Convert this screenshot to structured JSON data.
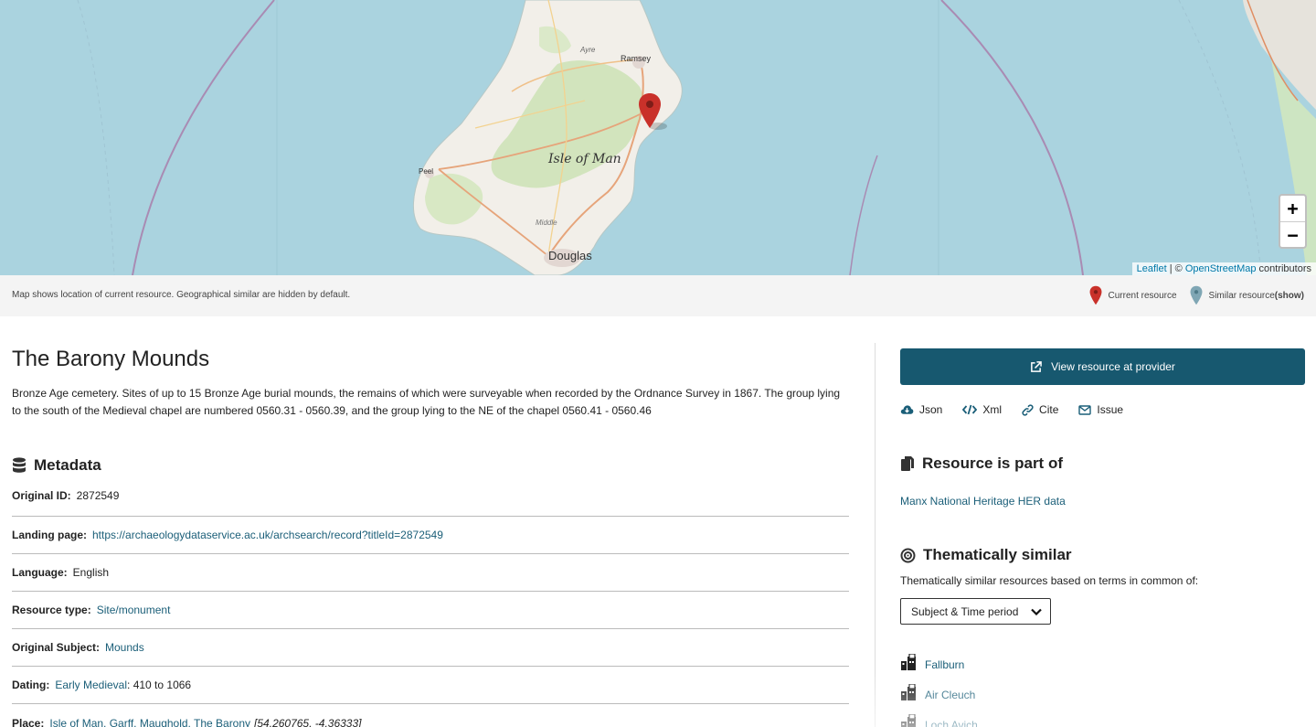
{
  "map": {
    "labels": {
      "isle": "Isle of Man",
      "ramsey": "Ramsey",
      "ayre": "Ayre",
      "peel": "Peel",
      "middle": "Middle",
      "douglas": "Douglas"
    },
    "zoom_in": "+",
    "zoom_out": "−",
    "attribution": {
      "leaflet": "Leaflet",
      "sep": " | © ",
      "osm": "OpenStreetMap",
      "contributors": " contributors"
    }
  },
  "mapbar": {
    "note": "Map shows location of current resource. Geographical similar are hidden by default.",
    "current_label": "Current resource",
    "similar_label": "Similar resource ",
    "similar_show": "(show)",
    "current_color": "#c9312a",
    "similar_color": "#7fa6b4"
  },
  "resource": {
    "title": "The Barony Mounds",
    "description": "Bronze Age cemetery. Sites of up to 15 Bronze Age burial mounds, the remains of which were surveyable when recorded by the Ordnance Survey in 1867. The group lying to the south of the Medieval chapel are numbered 0560.31 - 0560.39, and the group lying to the NE of the chapel 0560.41 - 0560.46"
  },
  "metadata": {
    "heading": "Metadata",
    "icon": "database-icon",
    "rows": {
      "original_id": {
        "label": "Original ID:",
        "value": "2872549"
      },
      "landing_page": {
        "label": "Landing page:",
        "value": "https://archaeologydataservice.ac.uk/archsearch/record?titleId=2872549"
      },
      "language": {
        "label": "Language:",
        "value": "English"
      },
      "resource_type": {
        "label": "Resource type:",
        "value": "Site/monument"
      },
      "original_subject": {
        "label": "Original Subject:",
        "value": "Mounds"
      },
      "dating": {
        "label": "Dating:",
        "link": "Early Medieval",
        "value": ": 410 to 1066"
      },
      "place": {
        "label": "Place:",
        "link": "Isle of Man, Garff, Maughold, The Barony",
        "coords": "[54.260765, -4.36333]"
      }
    }
  },
  "actions": {
    "view_provider": "View resource at provider",
    "json": "Json",
    "xml": "Xml",
    "cite": "Cite",
    "issue": "Issue"
  },
  "part_of": {
    "heading": "Resource is part of",
    "link": "Manx National Heritage HER data"
  },
  "thematic": {
    "heading": "Thematically similar",
    "description": "Thematically similar resources based on terms in common of:",
    "select_value": "Subject & Time period",
    "items": [
      "Fallburn",
      "Air Cleuch",
      "Loch Avich"
    ]
  },
  "colors": {
    "accent": "#17586f",
    "link": "#1a5e78",
    "water": "#aad3df"
  }
}
